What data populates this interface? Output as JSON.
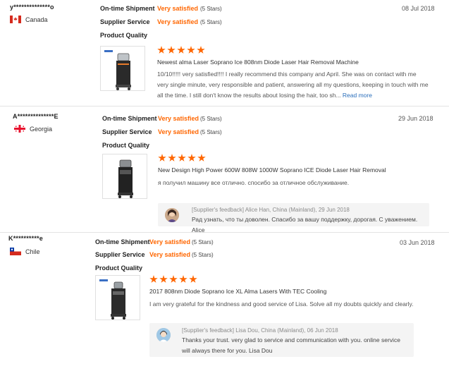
{
  "reviews": [
    {
      "buyer": "y**************o",
      "country": "Canada",
      "labels": {
        "shipment": "On-time Shipment",
        "service": "Supplier Service",
        "quality": "Product Quality"
      },
      "shipment_value": "Very satisfied",
      "shipment_stars": "(5 Stars)",
      "service_value": "Very satisfied",
      "service_stars": "(5 Stars)",
      "date": "08 Jul 2018",
      "quality_stars": 5,
      "product_title": "Newest alma Laser Soprano Ice 808nm Diode Laser Hair Removal Machine",
      "comment": "10/10!!!!! very satisfied!!!! I really recommend this company and April. She was on contact with me very single minute, very responsible and patient, answering all my questions, keeping in touch with me all the time. I still don't know the results about losing the hair, too sh...",
      "read_more": "Read more"
    },
    {
      "buyer": "A**************E",
      "country": "Georgia",
      "labels": {
        "shipment": "On-time Shipment",
        "service": "Supplier Service",
        "quality": "Product Quality"
      },
      "shipment_value": "Very satisfied",
      "shipment_stars": "(5 Stars)",
      "service_value": "Very satisfied",
      "service_stars": "(5 Stars)",
      "date": "29 Jun 2018",
      "quality_stars": 5,
      "product_title": "New Design High Power 600W 808W 1000W Soprano ICE Diode Laser Hair Removal",
      "comment": "я получил машину все отлично. спосибо за отличное обслуживание.",
      "feedback_head": "[Supplier's feedback] Alice Han, China (Mainland), 29 Jun 2018",
      "feedback_text": "Рад узнать, что ты доволен. Спасибо за вашу поддержку, дорогая. С уважением. Alice"
    },
    {
      "buyer": "K**********e",
      "country": "Chile",
      "labels": {
        "shipment": "On-time Shipment",
        "service": "Supplier Service",
        "quality": "Product Quality"
      },
      "shipment_value": "Very satisfied",
      "shipment_stars": "(5 Stars)",
      "service_value": "Very satisfied",
      "service_stars": "(5 Stars)",
      "date": "03 Jun 2018",
      "quality_stars": 5,
      "product_title": "2017 808nm Diode Soprano Ice XL Alma Lasers With TEC Cooling",
      "comment": "I am very grateful for the kindness and good service of Lisa. Solve all my doubts quickly and clearly.",
      "feedback_head": "[Supplier's feedback] Lisa Dou, China (Mainland), 06 Jun 2018",
      "feedback_text": "Thanks your trust. very glad to service and communication with you. online service will always there for you. Lisa Dou"
    }
  ],
  "colors": {
    "accent": "#ff6600",
    "link": "#2a6ebb"
  },
  "icons": {
    "star": "star-icon",
    "machine": "laser-machine-image"
  }
}
